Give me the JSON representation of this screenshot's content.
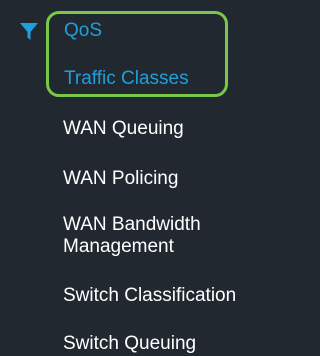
{
  "colors": {
    "background": "#222830",
    "active": "#1e9fdc",
    "text": "#ffffff",
    "highlight": "#79c946"
  },
  "icons": {
    "filter": "filter-funnel-icon"
  },
  "menu": {
    "section_label": "QoS",
    "items": [
      {
        "label": "Traffic Classes"
      },
      {
        "label": "WAN Queuing"
      },
      {
        "label": "WAN Policing"
      },
      {
        "label": "WAN Bandwidth Management"
      },
      {
        "label": "Switch Classification"
      },
      {
        "label": "Switch Queuing"
      }
    ]
  }
}
